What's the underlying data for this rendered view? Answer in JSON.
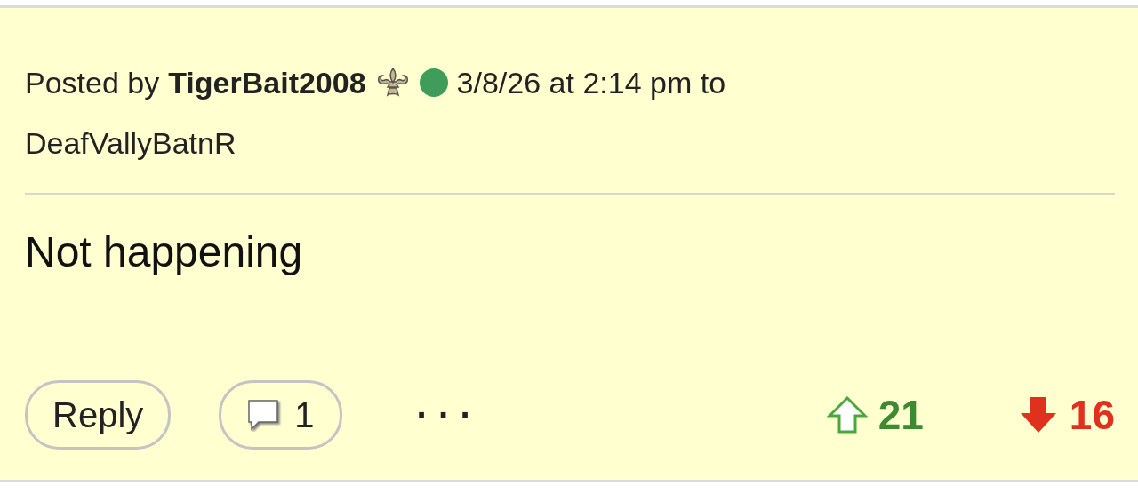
{
  "post": {
    "prefix": "Posted by",
    "author": "TigerBait2008",
    "online": true,
    "timestamp": "3/8/26 at 2:14 pm to",
    "recipient": "DeafVallyBatnR",
    "body": "Not happening",
    "actions": {
      "reply": "Reply",
      "comments": "1",
      "more": "· · ·",
      "upvotes": "21",
      "downvotes": "16"
    }
  }
}
